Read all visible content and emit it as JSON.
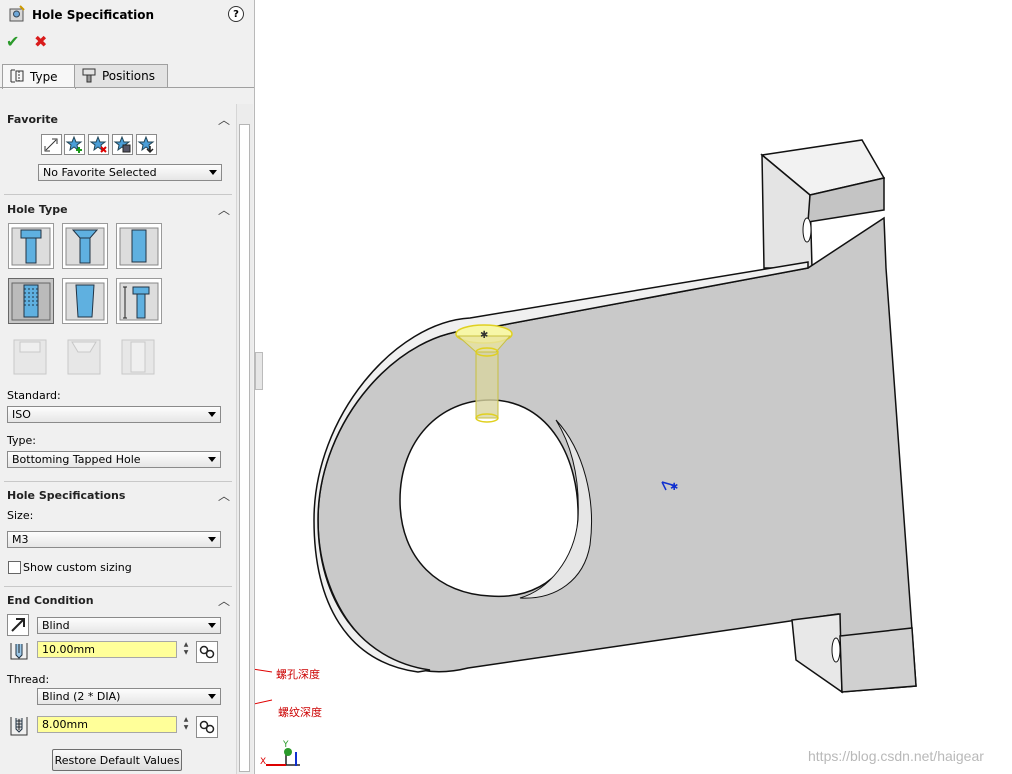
{
  "header": {
    "title": "Hole Specification",
    "help": "?",
    "ok_icon": "✔",
    "cancel_icon": "✖"
  },
  "tabs": [
    {
      "label": "Type"
    },
    {
      "label": "Positions"
    }
  ],
  "favorite": {
    "section": "Favorite",
    "selected": "No Favorite Selected"
  },
  "hole_type": {
    "section": "Hole Type",
    "standard_label": "Standard:",
    "standard_value": "ISO",
    "type_label": "Type:",
    "type_value": "Bottoming Tapped Hole"
  },
  "hole_spec": {
    "section": "Hole Specifications",
    "size_label": "Size:",
    "size_value": "M3",
    "custom_sizing": "Show custom sizing"
  },
  "end_condition": {
    "section": "End Condition",
    "condition_value": "Blind",
    "depth_value": "10.00mm",
    "thread_label": "Thread:",
    "thread_value": "Blind (2 * DIA)",
    "thread_depth_value": "8.00mm"
  },
  "restore_button": "Restore Default Values",
  "annotations": {
    "hole_depth": "螺孔深度",
    "thread_depth": "螺纹深度"
  },
  "watermark": "https://blog.csdn.net/haigear",
  "triad": {
    "x": "X",
    "y": "Y"
  },
  "colors": {
    "highlight": "#ffff99",
    "part": "#c8c8c8",
    "arrow": "#e00000"
  }
}
